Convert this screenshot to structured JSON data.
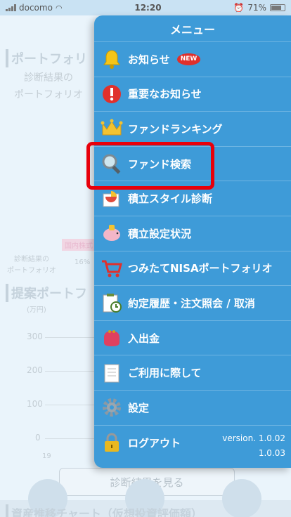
{
  "status_bar": {
    "carrier": "docomo",
    "time": "12:20",
    "battery": "71%"
  },
  "background_page": {
    "section1_title": "ポートフォリ",
    "section1_sub1": "診断結果の",
    "section1_sub2": "ポートフォリオ",
    "legend_label1": "診断結果の",
    "legend_label2": "ポートフォリオ",
    "percent": "16%",
    "pink_badge": "国内株式",
    "section2_title": "提案ポートフ",
    "unit": "(万円)",
    "axis": [
      "300",
      "200",
      "100",
      "0"
    ],
    "axis_first_x": "19",
    "button_label": "診断結果を見る",
    "section3_title": "資産推移チャート（仮想投資評価額）"
  },
  "menu": {
    "title": "メニュー",
    "new_badge": "NEW",
    "items": [
      {
        "label": "お知らせ",
        "icon": "bell-icon"
      },
      {
        "label": "重要なお知らせ",
        "icon": "alert-icon"
      },
      {
        "label": "ファンドランキング",
        "icon": "crown-icon"
      },
      {
        "label": "ファンド検索",
        "icon": "magnifier-icon"
      },
      {
        "label": "積立スタイル診断",
        "icon": "chart-icon"
      },
      {
        "label": "積立設定状況",
        "icon": "piggy-bank-icon"
      },
      {
        "label": "つみたてNISAポートフォリオ",
        "icon": "cart-icon"
      },
      {
        "label": "約定履歴・注文照会 / 取消",
        "icon": "clipboard-clock-icon"
      },
      {
        "label": "入出金",
        "icon": "purse-icon"
      },
      {
        "label": "ご利用に際して",
        "icon": "document-icon"
      },
      {
        "label": "設定",
        "icon": "gear-icon"
      },
      {
        "label": "ログアウト",
        "icon": "padlock-icon"
      }
    ],
    "version_line1": "version. 1.0.02",
    "version_line2": "1.0.03"
  }
}
